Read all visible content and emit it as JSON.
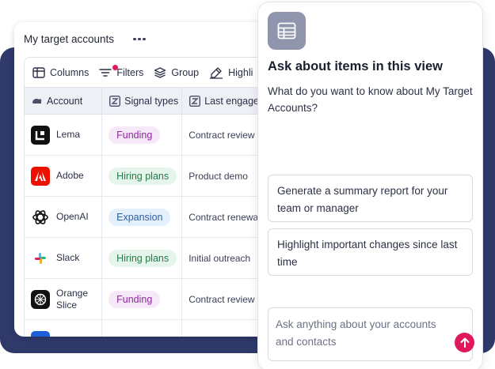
{
  "table_view": {
    "title": "My target accounts",
    "toolbar": {
      "columns_label": "Columns",
      "filters_label": "Filters",
      "group_label": "Group",
      "highlight_label": "Highli"
    },
    "columns": {
      "account": "Account",
      "signal_types": "Signal types",
      "last_engagement": "Last engage"
    },
    "rows": [
      {
        "account": "Lema",
        "signal": "Funding",
        "engagement": "Contract review"
      },
      {
        "account": "Adobe",
        "signal": "Hiring plans",
        "engagement": "Product demo"
      },
      {
        "account": "OpenAI",
        "signal": "Expansion",
        "engagement": "Contract renewa"
      },
      {
        "account": "Slack",
        "signal": "Hiring plans",
        "engagement": "Initial outreach"
      },
      {
        "account": "Orange Slice",
        "signal": "Funding",
        "engagement": "Contract review"
      }
    ]
  },
  "assistant": {
    "title": "Ask about items in this view",
    "subtitle": "What do you want to know about My Target Accounts?",
    "suggestions": [
      "Generate a summary report for your team or manager",
      "Highlight important changes since last time"
    ],
    "input_placeholder": "Ask anything about your accounts and contacts"
  },
  "colors": {
    "backdrop": "#2f3a6b",
    "accent": "#e0195a",
    "funding_pill": "#f6e8f8",
    "hiring_pill": "#e5f5ec",
    "expansion_pill": "#e4effc"
  },
  "icons": [
    "more-icon",
    "columns-icon",
    "filter-icon",
    "group-icon",
    "highlight-icon",
    "account-icon",
    "signal-type-icon",
    "last-engagement-icon",
    "table-icon",
    "send-arrow-icon"
  ]
}
